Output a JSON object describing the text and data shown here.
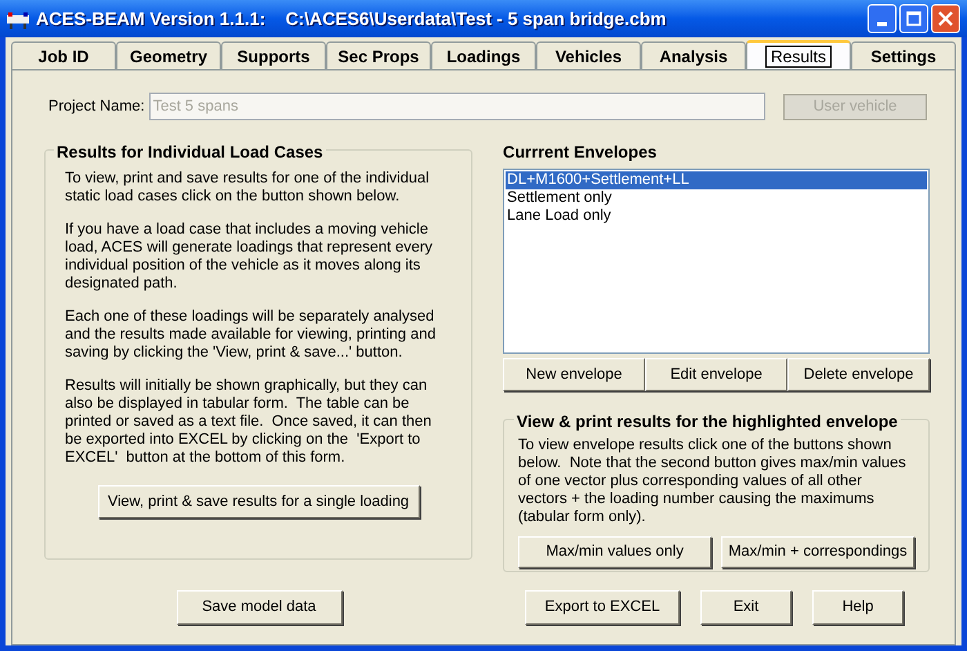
{
  "window": {
    "title": "ACES-BEAM Version 1.1.1:    C:\\ACES6\\Userdata\\Test - 5 span bridge.cbm"
  },
  "tabs": [
    {
      "label": "Job ID",
      "selected": false
    },
    {
      "label": "Geometry",
      "selected": false
    },
    {
      "label": "Supports",
      "selected": false
    },
    {
      "label": "Sec Props",
      "selected": false
    },
    {
      "label": "Loadings",
      "selected": false
    },
    {
      "label": "Vehicles",
      "selected": false
    },
    {
      "label": "Analysis",
      "selected": false
    },
    {
      "label": "Results",
      "selected": true
    },
    {
      "label": "Settings",
      "selected": false
    }
  ],
  "project": {
    "label": "Project Name:",
    "value": "Test 5 spans",
    "disabled": true
  },
  "user_vehicle": {
    "label": "User vehicle",
    "disabled": true
  },
  "individual": {
    "title": "Results for Individual Load Cases",
    "paragraphs": [
      "To view, print and save results for one of the individual static load cases click on the button shown below.",
      "If you have a load case that includes a moving vehicle load, ACES will generate loadings that represent every individual position of the vehicle as it moves along its designated path.",
      "Each one of these loadings will be separately analysed and the results made available for viewing, printing and saving by clicking the 'View, print & save...' button.",
      "Results will initially be shown graphically, but they can also be displayed in tabular form.  The table can be printed or saved as a text file.  Once saved, it can then be exported into EXCEL by clicking on the  'Export to EXCEL'  button at the bottom of this form."
    ],
    "button": "View, print & save results for a single loading"
  },
  "envelopes": {
    "title": "Currrent Envelopes",
    "items": [
      {
        "label": "DL+M1600+Settlement+LL",
        "selected": true
      },
      {
        "label": "Settlement only",
        "selected": false
      },
      {
        "label": "Lane Load only",
        "selected": false
      }
    ],
    "buttons": [
      "New envelope",
      "Edit envelope",
      "Delete envelope"
    ]
  },
  "highlighted": {
    "title": "View & print results for the highlighted envelope",
    "text": "To view envelope results click one of the buttons shown below.  Note that the second button gives max/min values of one vector plus corresponding values of all other vectors + the loading number causing the maximums (tabular form only).",
    "buttons": [
      "Max/min values only",
      "Max/min + correspondings"
    ]
  },
  "footer": {
    "left": [
      "Save model data"
    ],
    "right": [
      "Export to EXCEL",
      "Exit",
      "Help"
    ]
  }
}
